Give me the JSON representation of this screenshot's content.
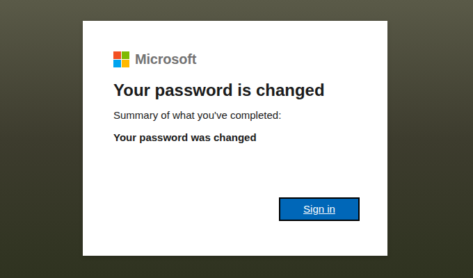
{
  "logo": {
    "text": "Microsoft"
  },
  "heading": "Your password is changed",
  "subtitle": "Summary of what you've completed:",
  "summary": [
    "Your password was changed"
  ],
  "buttons": [
    "Sign in"
  ]
}
